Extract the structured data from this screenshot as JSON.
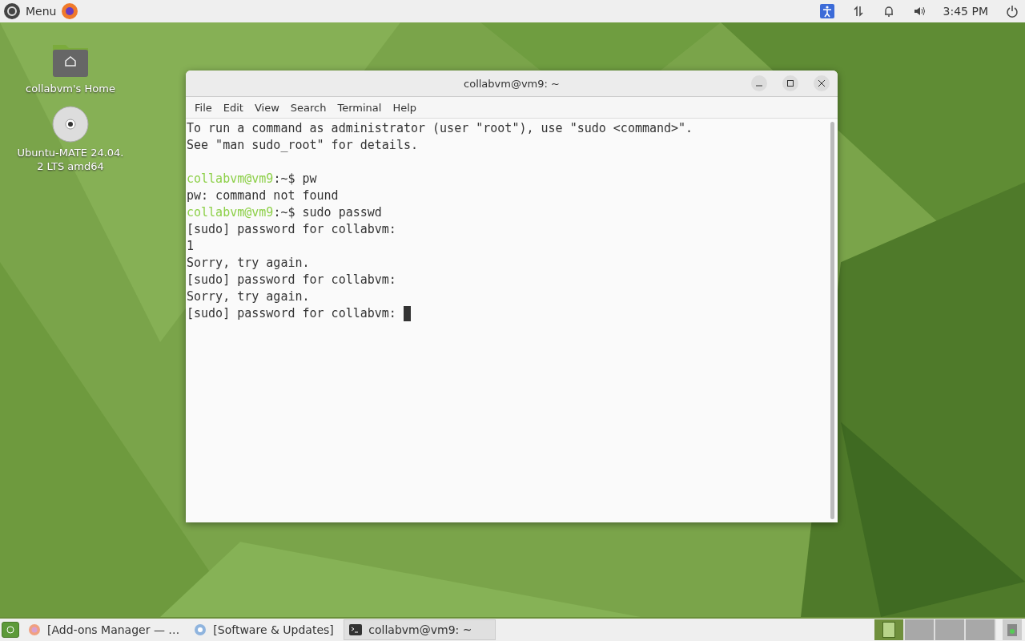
{
  "top_panel": {
    "menu_label": "Menu",
    "clock": "3:45 PM"
  },
  "desktop_icons": [
    {
      "kind": "folder",
      "label": "collabvm's Home"
    },
    {
      "kind": "disc",
      "label": "Ubuntu-MATE 24.04.\n2 LTS amd64"
    }
  ],
  "terminal": {
    "title": "collabvm@vm9: ~",
    "menu": [
      "File",
      "Edit",
      "View",
      "Search",
      "Terminal",
      "Help"
    ],
    "lines": [
      {
        "kind": "output",
        "text": "To run a command as administrator (user \"root\"), use \"sudo <command>\"."
      },
      {
        "kind": "output",
        "text": "See \"man sudo_root\" for details."
      },
      {
        "kind": "blank"
      },
      {
        "kind": "prompt",
        "user": "collabvm@vm9",
        "rest": ":~$ pw"
      },
      {
        "kind": "output",
        "text": "pw: command not found"
      },
      {
        "kind": "prompt",
        "user": "collabvm@vm9",
        "rest": ":~$ sudo passwd"
      },
      {
        "kind": "output",
        "text": "[sudo] password for collabvm:"
      },
      {
        "kind": "output",
        "text": "1"
      },
      {
        "kind": "output",
        "text": "Sorry, try again."
      },
      {
        "kind": "output",
        "text": "[sudo] password for collabvm:"
      },
      {
        "kind": "output",
        "text": "Sorry, try again."
      },
      {
        "kind": "output",
        "text": "[sudo] password for collabvm: ",
        "cursor": true
      }
    ]
  },
  "taskbar": {
    "tasks": [
      {
        "kind": "firefox",
        "label": "[Add-ons Manager — …",
        "selected": false
      },
      {
        "kind": "updates",
        "label": "[Software & Updates]",
        "selected": false
      },
      {
        "kind": "terminal",
        "label": "collabvm@vm9: ~",
        "selected": true
      }
    ],
    "workspaces": [
      {
        "selected": true
      },
      {
        "selected": false
      },
      {
        "selected": false
      },
      {
        "selected": false
      }
    ]
  }
}
